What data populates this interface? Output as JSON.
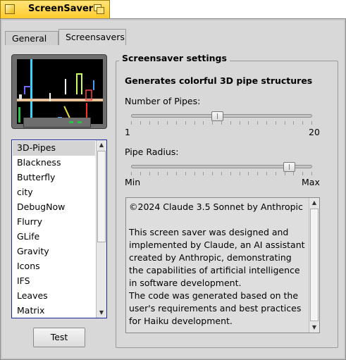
{
  "window": {
    "title": "ScreenSaver"
  },
  "tabs": [
    {
      "label": "General",
      "active": false
    },
    {
      "label": "Screensavers",
      "active": true
    }
  ],
  "screensaver_list": {
    "items": [
      "3D-Pipes",
      "Blackness",
      "Butterfly",
      "city",
      "DebugNow",
      "Flurry",
      "GLife",
      "Gravity",
      "Icons",
      "IFS",
      "Leaves",
      "Matrix"
    ],
    "selected": "3D-Pipes"
  },
  "test_button": "Test",
  "settings": {
    "group_title": "Screensaver settings",
    "description": "Generates colorful 3D pipe structures",
    "pipes_slider": {
      "label": "Number of Pipes:",
      "min_label": "1",
      "max_label": "20",
      "value": 10
    },
    "radius_slider": {
      "label": "Pipe Radius:",
      "min_label": "Min",
      "max_label": "Max",
      "value_fraction": 0.9
    },
    "about_text": "©2024 Claude 3.5 Sonnet by Anthropic\n\nThis screen saver was designed and implemented by Claude, an AI assistant created by Anthropic, demonstrating the capabilities of artificial intelligence in software development.\nThe code was generated based on the user's requirements and best practices for Haiku development."
  },
  "colors": {
    "tab_yellow": "#ffcb2a",
    "panel_gray": "#d8d8d8",
    "list_border": "#1a2a9a"
  }
}
